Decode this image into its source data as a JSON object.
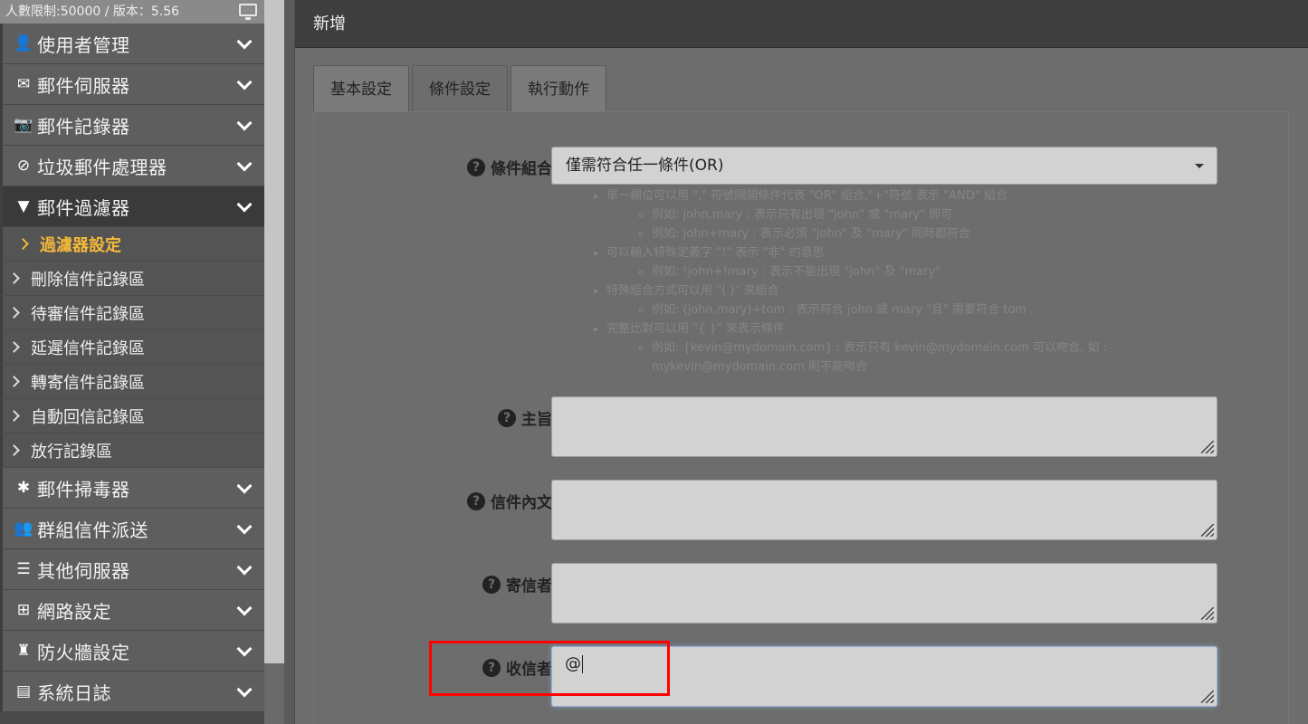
{
  "sidebar": {
    "top_info": "人數限制:50000 / 版本：5.56",
    "top_icon": "monitor-icon",
    "menu_before": [
      {
        "label": "使用者管理",
        "icon": "user-icon",
        "glyph": "👤"
      },
      {
        "label": "郵件伺服器",
        "icon": "envelope-icon",
        "glyph": "✉"
      },
      {
        "label": "郵件記錄器",
        "icon": "camera-icon",
        "glyph": "📷"
      },
      {
        "label": "垃圾郵件處理器",
        "icon": "ban-icon",
        "glyph": "⊘"
      },
      {
        "label": "郵件過濾器",
        "icon": "filter-icon",
        "glyph": "▼"
      }
    ],
    "submenu": [
      {
        "label": "過濾器設定",
        "active": true
      },
      {
        "label": "刪除信件記錄區"
      },
      {
        "label": "待審信件記錄區"
      },
      {
        "label": "延遲信件記錄區"
      },
      {
        "label": "轉寄信件記錄區"
      },
      {
        "label": "自動回信記錄區"
      },
      {
        "label": "放行記錄區"
      }
    ],
    "menu_after": [
      {
        "label": "郵件掃毒器",
        "icon": "bug-icon",
        "glyph": "✱"
      },
      {
        "label": "群組信件派送",
        "icon": "users-icon",
        "glyph": "👥"
      },
      {
        "label": "其他伺服器",
        "icon": "server-icon",
        "glyph": "☰"
      },
      {
        "label": "網路設定",
        "icon": "sitemap-icon",
        "glyph": "⊞"
      },
      {
        "label": "防火牆設定",
        "icon": "castle-icon",
        "glyph": "♜"
      },
      {
        "label": "系統日誌",
        "icon": "film-icon",
        "glyph": "▤"
      }
    ]
  },
  "panel": {
    "title": "新增",
    "tabs": [
      "基本設定",
      "條件設定",
      "執行動作"
    ],
    "active_tab": 1
  },
  "form": {
    "combo_label": "條件組合",
    "combo_value": "僅需符合任一條件(OR)",
    "help": [
      {
        "text": "單一欄位可以用 \",\" 符號隔開條件代表 \"OR\" 組合,\"+\"符號 表示 \"AND\" 組合",
        "subs": [
          "例如: john,mary : 表示只有出現 \"john\" 或 \"mary\" 即可",
          "例如: john+mary : 表示必須 \"john\" 及 \"mary\" 同時都符合"
        ]
      },
      {
        "text": "可以輸入特殊定義字 \"!\" 表示 \"非\" 的意思",
        "subs": [
          "例如: !john+!mary : 表示不能出現 \"john\" 及 \"mary\" ."
        ]
      },
      {
        "text": "特殊組合方式可以用 \"( )\" 來組合",
        "subs": [
          "例如: (john,mary)+tom : 表示符合 john 或 mary \"且\" 需要符合 tom ."
        ]
      },
      {
        "text": "完整比對可以用 \"{ }\" 來表示條件",
        "subs": [
          "例如: {kevin@mydomain.com} : 表示只有 kevin@mydomain.com 可以吻合, 如 : mykevin@mydomain.com 則不能吻合"
        ]
      }
    ],
    "subject_label": "主旨",
    "subject_value": "",
    "body_label": "信件內文",
    "body_value": "",
    "sender_label": "寄信者",
    "sender_value": "",
    "recipient_label": "收信者",
    "recipient_value": "@"
  },
  "colors": {
    "highlight": "#ff0000",
    "active_submenu": "#f5b93a"
  }
}
